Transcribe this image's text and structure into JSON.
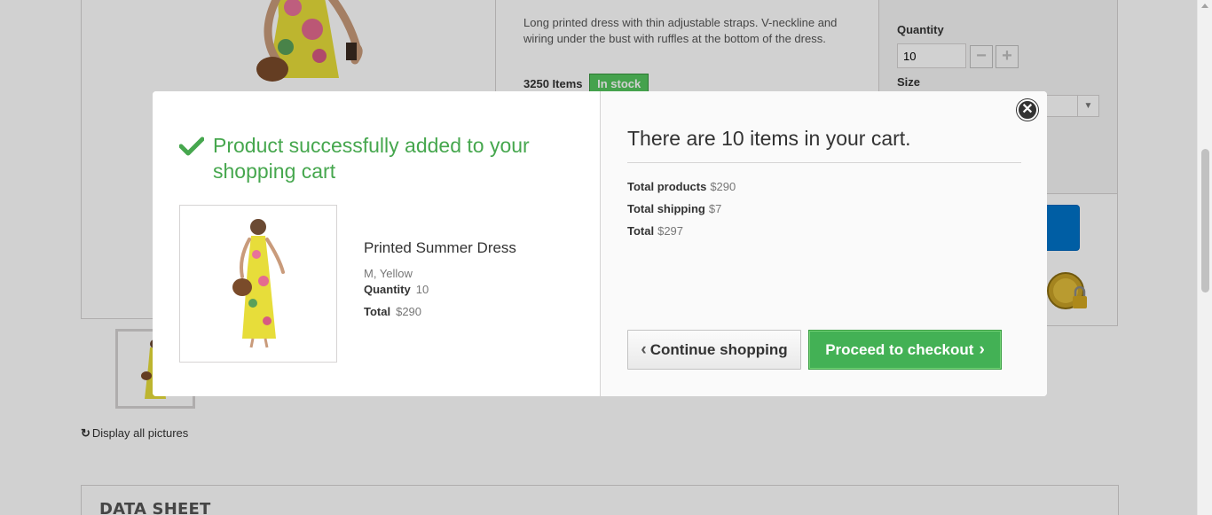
{
  "product_page": {
    "description": "Long printed dress with thin adjustable straps. V-neckline and wiring under the bust with ruffles at the bottom of the dress.",
    "stock_quantity": "3250 Items",
    "stock_status": "In stock",
    "quantity_label": "Quantity",
    "quantity_value": "10",
    "size_label": "Size",
    "display_all_pictures": "Display all pictures",
    "data_sheet_title": "DATA SHEET"
  },
  "modal": {
    "success_message": "Product successfully added to your shopping cart",
    "product": {
      "name": "Printed Summer Dress",
      "attributes": "M, Yellow",
      "quantity_label": "Quantity",
      "quantity_value": "10",
      "total_label": "Total",
      "total_value": "$290"
    },
    "cart_summary": {
      "heading": "There are 10 items in your cart.",
      "total_products_label": "Total products",
      "total_products_value": "$290",
      "total_shipping_label": "Total shipping",
      "total_shipping_value": "$7",
      "total_label": "Total",
      "total_value": "$297"
    },
    "continue_button": "Continue shopping",
    "checkout_button": "Proceed to checkout"
  },
  "colors": {
    "success_green": "#46a74e",
    "checkout_button": "#43b155",
    "stock_badge": "#55c65e",
    "add_to_cart_blue": "#0073c8"
  }
}
